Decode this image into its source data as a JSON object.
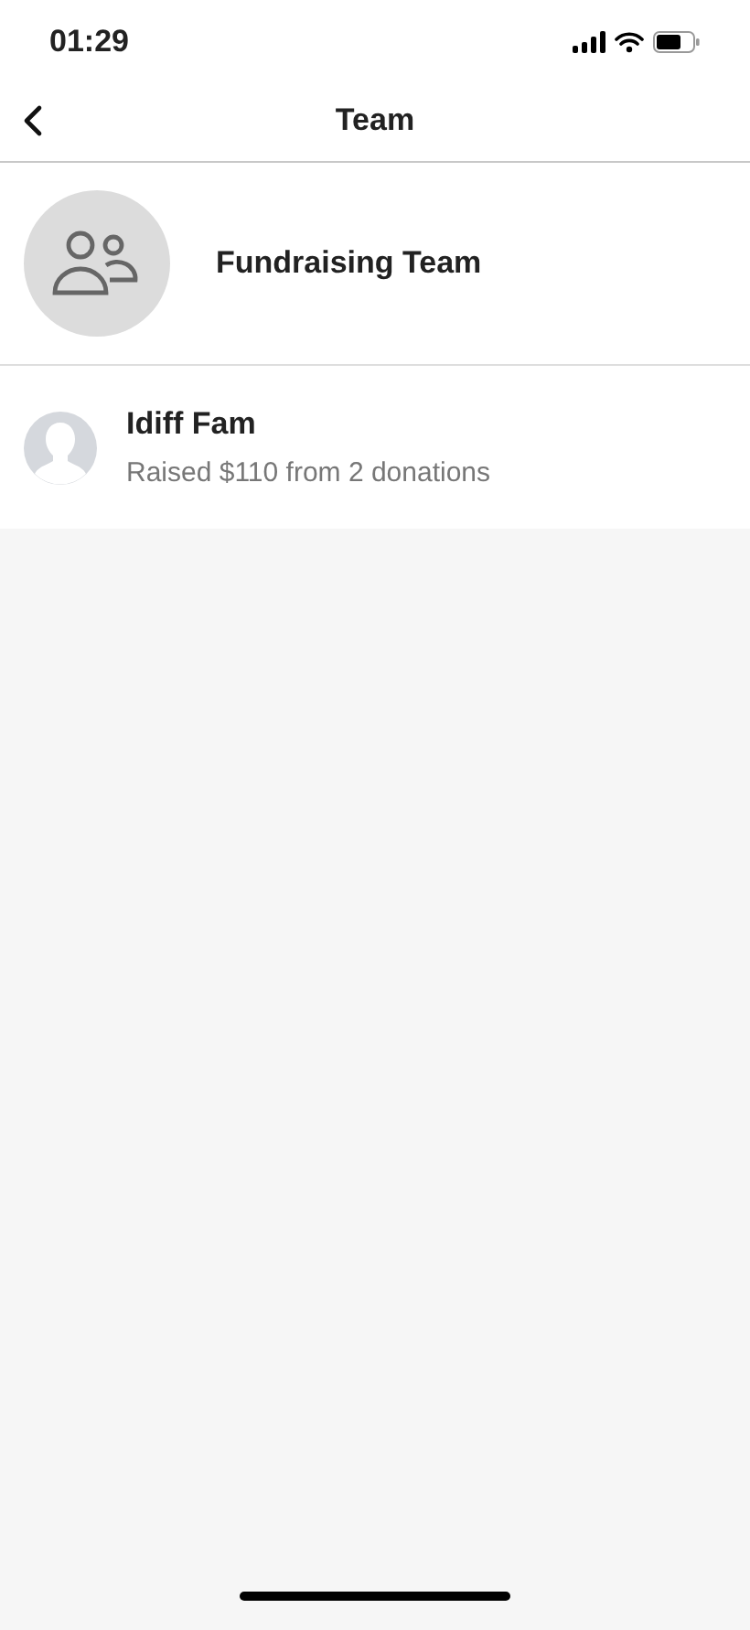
{
  "status_bar": {
    "time": "01:29"
  },
  "nav": {
    "title": "Team"
  },
  "team": {
    "name": "Fundraising Team"
  },
  "members": [
    {
      "name": "Idiff Fam",
      "summary": "Raised $110 from 2 donations"
    }
  ]
}
